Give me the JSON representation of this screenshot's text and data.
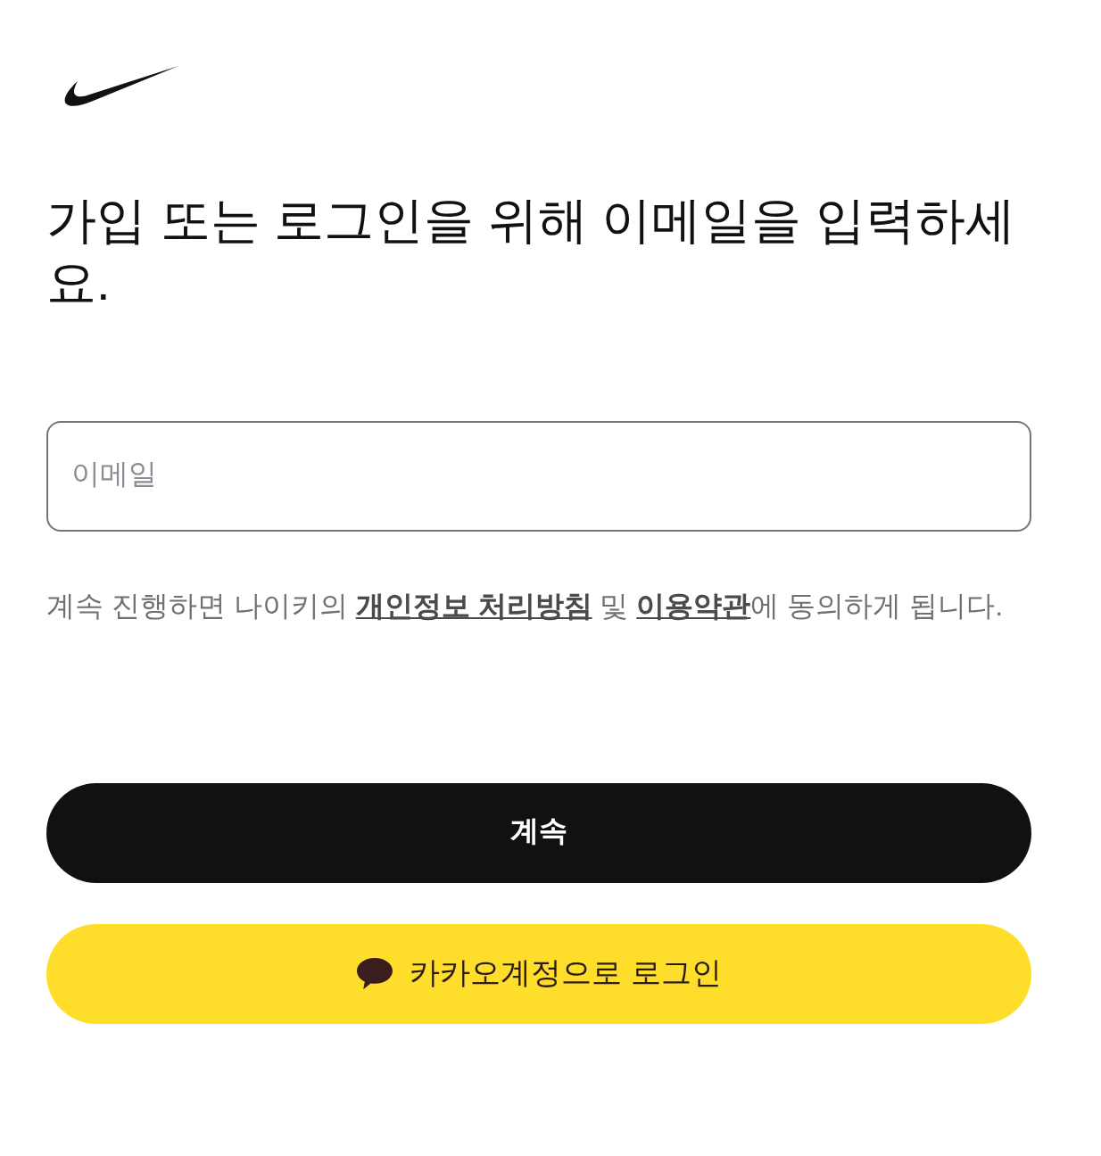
{
  "heading": "가입 또는 로그인을 위해 이메일을 입력하세요.",
  "email_field": {
    "placeholder": "이메일"
  },
  "consent": [
    {
      "kind": "text",
      "text": "계속 진행하면 나이키의 "
    },
    {
      "kind": "link",
      "text": "개인정보 처리방침"
    },
    {
      "kind": "text",
      "text": " 및 "
    },
    {
      "kind": "link",
      "text": "이용약관"
    },
    {
      "kind": "text",
      "text": "에 동의하게 됩니다."
    }
  ],
  "buttons": [
    {
      "kind": "primary",
      "label": "계속"
    },
    {
      "kind": "kakao",
      "label": "카카오계정으로 로그인"
    }
  ]
}
